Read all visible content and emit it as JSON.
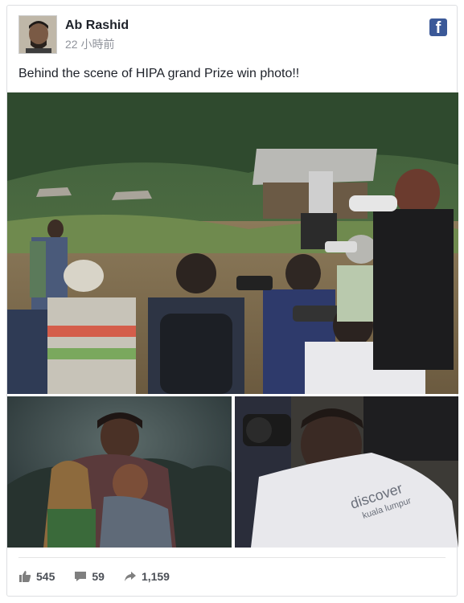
{
  "post": {
    "author": "Ab Rashid",
    "time": "22 小時前",
    "text": "Behind the scene of HIPA grand Prize win photo!!",
    "platform_icon": "f"
  },
  "stats": {
    "likes": "545",
    "comments": "59",
    "shares": "1,159"
  },
  "colors": {
    "brand": "#3b5998",
    "text": "#1d2129",
    "muted": "#90949c"
  },
  "photos": {
    "right_shirt_text_line1": "discover",
    "right_shirt_text_line2": "kuala lumpur"
  }
}
